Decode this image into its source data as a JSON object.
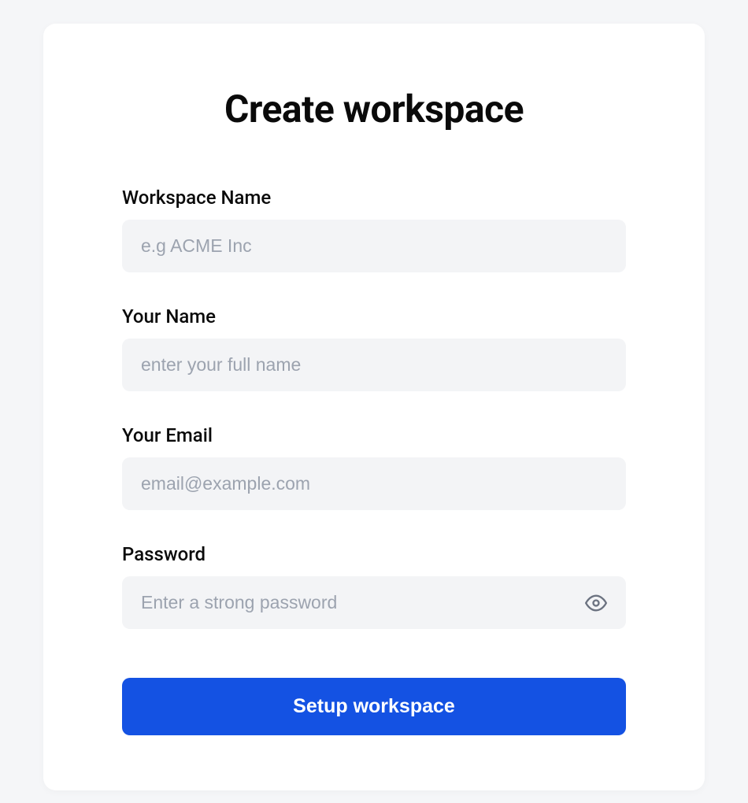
{
  "title": "Create workspace",
  "fields": {
    "workspace": {
      "label": "Workspace Name",
      "placeholder": "e.g ACME Inc",
      "value": ""
    },
    "name": {
      "label": "Your Name",
      "placeholder": "enter your full name",
      "value": ""
    },
    "email": {
      "label": "Your Email",
      "placeholder": "email@example.com",
      "value": ""
    },
    "password": {
      "label": "Password",
      "placeholder": "Enter a strong password",
      "value": ""
    }
  },
  "submit_label": "Setup workspace",
  "colors": {
    "primary": "#1452e3",
    "input_bg": "#f3f4f6",
    "placeholder": "#9ca3af"
  }
}
